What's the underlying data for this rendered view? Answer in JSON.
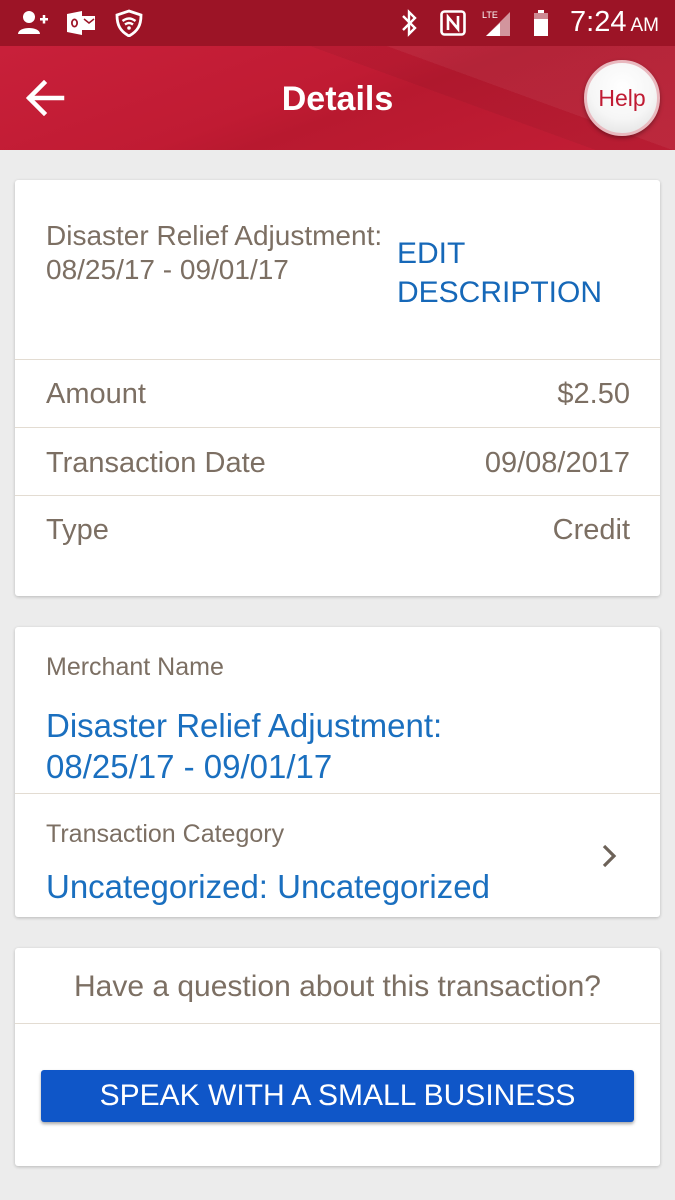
{
  "status_bar": {
    "time": "7:24",
    "ampm": "AM",
    "left_icons": [
      "add-contact-icon",
      "outlook-icon",
      "wifi-shield-icon"
    ],
    "right_icons": [
      "bluetooth-icon",
      "nfc-icon",
      "lte-signal-icon",
      "battery-icon"
    ],
    "network_label": "LTE"
  },
  "app_bar": {
    "title": "Details",
    "help_label": "Help",
    "back_icon": "back-arrow-icon",
    "accent_color": "#c01b33"
  },
  "summary_card": {
    "description": "Disaster Relief Adjustment: 08/25/17 - 09/01/17",
    "edit_label_line1": "EDIT",
    "edit_label_line2": "DESCRIPTION",
    "rows": [
      {
        "label": "Amount",
        "value": "$2.50"
      },
      {
        "label": "Transaction Date",
        "value": "09/08/2017"
      },
      {
        "label": "Type",
        "value": "Credit"
      }
    ]
  },
  "merchant_card": {
    "merchant_label": "Merchant Name",
    "merchant_value": "Disaster Relief Adjustment: 08/25/17 - 09/01/17",
    "category_label": "Transaction Category",
    "category_value": "Uncategorized: Uncategorized"
  },
  "question_card": {
    "question": "Have a question about this transaction?",
    "button_label": "SPEAK WITH A SMALL BUSINESS"
  },
  "colors": {
    "brand_red": "#c01b33",
    "link_blue": "#1668b8",
    "button_blue": "#0f56c8",
    "text_taupe": "#7c6f63"
  }
}
